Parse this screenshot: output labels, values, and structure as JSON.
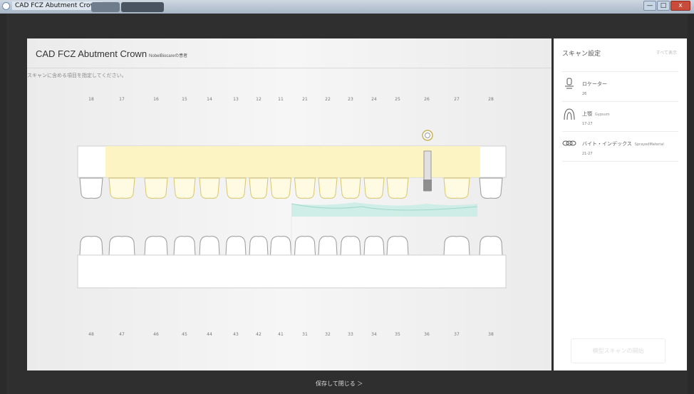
{
  "window": {
    "title": "CAD FCZ Abutment Crown",
    "minimize_label": "—",
    "maximize_label": "□",
    "close_label": "x"
  },
  "card": {
    "title": "CAD FCZ Abutment Crown",
    "patient": "NobelBiocareの患者",
    "instruction": "スキャンに含める項目を指定してください。"
  },
  "upper_teeth_numbers": [
    "18",
    "17",
    "16",
    "15",
    "14",
    "13",
    "12",
    "11",
    "21",
    "22",
    "23",
    "24",
    "25",
    "26",
    "27",
    "28"
  ],
  "lower_teeth_numbers": [
    "48",
    "47",
    "46",
    "45",
    "44",
    "43",
    "42",
    "41",
    "31",
    "32",
    "33",
    "34",
    "35",
    "36",
    "37",
    "38"
  ],
  "side_panel": {
    "title": "スキャン設定",
    "all_link": "すべて表示",
    "items": [
      {
        "icon": "locator-icon",
        "label": "ロケーター",
        "note": "",
        "sub": "26"
      },
      {
        "icon": "upper-jaw-icon",
        "label": "上顎",
        "note": "Gypsum",
        "sub": "17-27"
      },
      {
        "icon": "bite-index-icon",
        "label": "バイト・インデックス",
        "note": "SprayedMaterial",
        "sub": "21-27"
      }
    ],
    "start_button": "模型スキャンの開始"
  },
  "footer": {
    "save_close": "保存して閉じる ＞"
  },
  "colors": {
    "highlight_yellow": "#fbf3b8",
    "tooth_outline_selected": "#d8c667",
    "gingiva_teal": "#c4ece3"
  }
}
